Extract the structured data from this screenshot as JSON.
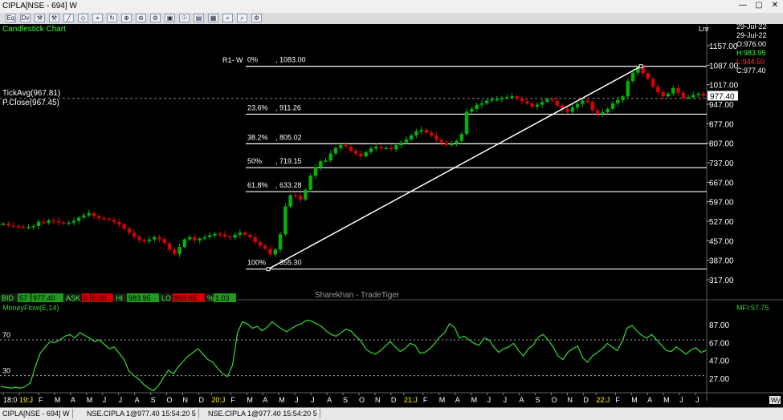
{
  "window": {
    "title": "CIPLA[NSE - 694] W",
    "controls": [
      "—",
      "▢",
      "✕"
    ]
  },
  "toolbar": {
    "icons": [
      "easy-order-icon",
      "easy-order-icon",
      "pin-icon",
      "pin-icon",
      "draw-line-icon",
      "draw-tool-icon",
      "draw-tool-icon",
      "refresh-icon",
      "zoom-icon",
      "zoom-icon",
      "settings-icon",
      "settings-icon",
      "settings-icon",
      "settings-icon",
      "settings-icon",
      "zoom-icon",
      "zoom-icon",
      "settings-icon"
    ],
    "icon_glyphs": [
      "Eq",
      "Dv",
      "⚒",
      "⚒",
      "╱",
      "◇",
      "⌖",
      "↻",
      "⊕",
      "⊖",
      "⚙",
      "▣",
      "☉",
      "▤",
      "▦",
      "⌕",
      "⌕",
      "⚙"
    ]
  },
  "chart_header": {
    "title": "Candlestick Chart",
    "scale_label": "Lnr",
    "dates": [
      "29-Jul-22",
      "29-Jul-22"
    ],
    "ohlc": {
      "O": "O:976.00",
      "H": "H:983.95",
      "L": "L:944.50",
      "C": "C:977.40"
    },
    "tick_avg": "TickAvg(967.81)",
    "prev_close": "P.Close(967.45)",
    "current_price": "977.40",
    "watermark": "Sharekhan - TradeTiger"
  },
  "quote_bar": [
    {
      "label": "BID",
      "value": "57"
    },
    {
      "label": "",
      "value": "977.40"
    },
    {
      "label": "ASK",
      "value": "0"
    },
    {
      "label": "",
      "value": "0.00"
    },
    {
      "label": "HI",
      "value": "983.95"
    },
    {
      "label": "LO",
      "value": "953.05"
    },
    {
      "label": "%",
      "value": "1.03"
    }
  ],
  "chart_data": [
    {
      "type": "candlestick",
      "title": "Candlestick Chart",
      "y_ticks": [
        "1157.00",
        "1087.00",
        "1017.00",
        "947.00",
        "877.00",
        "807.00",
        "737.00",
        "667.00",
        "597.00",
        "527.00",
        "457.00",
        "387.00",
        "317.00"
      ],
      "ylim": [
        290,
        1190
      ],
      "x_ticks": [
        "18:0",
        "19:J",
        "F",
        "M",
        "A",
        "M",
        "J",
        "J",
        "A",
        "S",
        "O",
        "N",
        "D",
        "20:J",
        "F",
        "M",
        "A",
        "M",
        "J",
        "J",
        "A",
        "S",
        "O",
        "N",
        "D",
        "21:J",
        "F",
        "M",
        "A",
        "M",
        "J",
        "J",
        "A",
        "S",
        "O",
        "N",
        "D",
        "22:J",
        "F",
        "M",
        "A",
        "M",
        "J",
        "J"
      ],
      "x_tick_colors": {
        "18:0": "#ffffff",
        "19:J": "#ffff00",
        "20:J": "#ffff00",
        "21:J": "#ffff00",
        "22:J": "#ffff00"
      },
      "up_color": "#00b400",
      "down_color": "#dc0000",
      "close_series": [
        518,
        512,
        510,
        507,
        505,
        506,
        510,
        525,
        522,
        530,
        528,
        523,
        519,
        522,
        528,
        540,
        548,
        556,
        545,
        538,
        536,
        532,
        525,
        515,
        500,
        485,
        472,
        460,
        455,
        462,
        470,
        463,
        448,
        425,
        410,
        435,
        462,
        470,
        458,
        465,
        470,
        476,
        482,
        480,
        472,
        468,
        478,
        486,
        478,
        470,
        452,
        440,
        428,
        408,
        425,
        480,
        580,
        620,
        618,
        605,
        640,
        690,
        720,
        742,
        745,
        770,
        790,
        800,
        795,
        780,
        770,
        760,
        775,
        788,
        795,
        790,
        790,
        785,
        800,
        810,
        820,
        835,
        850,
        855,
        845,
        835,
        820,
        810,
        800,
        805,
        815,
        840,
        920,
        930,
        945,
        950,
        960,
        965,
        965,
        970,
        972,
        975,
        968,
        958,
        950,
        938,
        945,
        955,
        965,
        960,
        942,
        930,
        920,
        935,
        948,
        960,
        955,
        925,
        912,
        918,
        930,
        950,
        962,
        975,
        1030,
        1060,
        1080,
        1058,
        1038,
        1010,
        990,
        975,
        985,
        1005,
        988,
        970,
        972,
        980,
        985,
        977
      ],
      "fibonacci": {
        "label": "R1- W",
        "levels": [
          {
            "pct": "0%",
            "value": 1083.0,
            "text": "1083.00"
          },
          {
            "pct": "23.6%",
            "value": 911.26,
            "text": "911.26"
          },
          {
            "pct": "38.2%",
            "value": 805.02,
            "text": "805.02"
          },
          {
            "pct": "50%",
            "value": 719.15,
            "text": "719.15"
          },
          {
            "pct": "61.8%",
            "value": 633.28,
            "text": "633.28"
          },
          {
            "pct": "100%",
            "value": 355.3,
            "text": "355.30"
          }
        ]
      },
      "tick_avg_value": 967.81
    },
    {
      "type": "line",
      "title": "MoneyFlow(E,14)",
      "last_label": "MFI:57.75",
      "y_ticks": [
        "87.00",
        "67.00",
        "47.00",
        "27.00"
      ],
      "ylim": [
        10,
        100
      ],
      "ref_levels": [
        {
          "value": 70,
          "text": "70"
        },
        {
          "value": 30,
          "text": "30"
        }
      ],
      "line_color": "#33cc33",
      "values": [
        18,
        17,
        16,
        17,
        16,
        18,
        22,
        40,
        55,
        62,
        68,
        67,
        70,
        74,
        76,
        72,
        78,
        75,
        72,
        68,
        70,
        65,
        60,
        62,
        55,
        48,
        35,
        30,
        26,
        20,
        16,
        13,
        19,
        28,
        36,
        32,
        40,
        46,
        52,
        56,
        60,
        54,
        48,
        45,
        38,
        32,
        29,
        42,
        78,
        90,
        88,
        83,
        85,
        80,
        84,
        90,
        86,
        82,
        79,
        83,
        86,
        88,
        92,
        91,
        88,
        85,
        80,
        76,
        74,
        78,
        82,
        80,
        74,
        69,
        60,
        56,
        54,
        58,
        63,
        68,
        62,
        57,
        60,
        66,
        64,
        55,
        56,
        60,
        66,
        73,
        78,
        88,
        84,
        72,
        74,
        70,
        66,
        64,
        72,
        70,
        62,
        56,
        60,
        62,
        66,
        58,
        52,
        60,
        64,
        73,
        76,
        70,
        62,
        52,
        48,
        56,
        60,
        63,
        50,
        45,
        52,
        56,
        60,
        66,
        62,
        58,
        68,
        83,
        86,
        80,
        75,
        72,
        76,
        70,
        64,
        58,
        57,
        62,
        58,
        54,
        59,
        61,
        56,
        58
      ]
    }
  ],
  "status_tabs": [
    "CIPLA[NSE - 694] W",
    "NSE.CIPLA 1@977.40 15:54:20 5",
    "NSE.CIPLA 1@977.40 15:54:20 5"
  ],
  "corner_label": "Wy"
}
